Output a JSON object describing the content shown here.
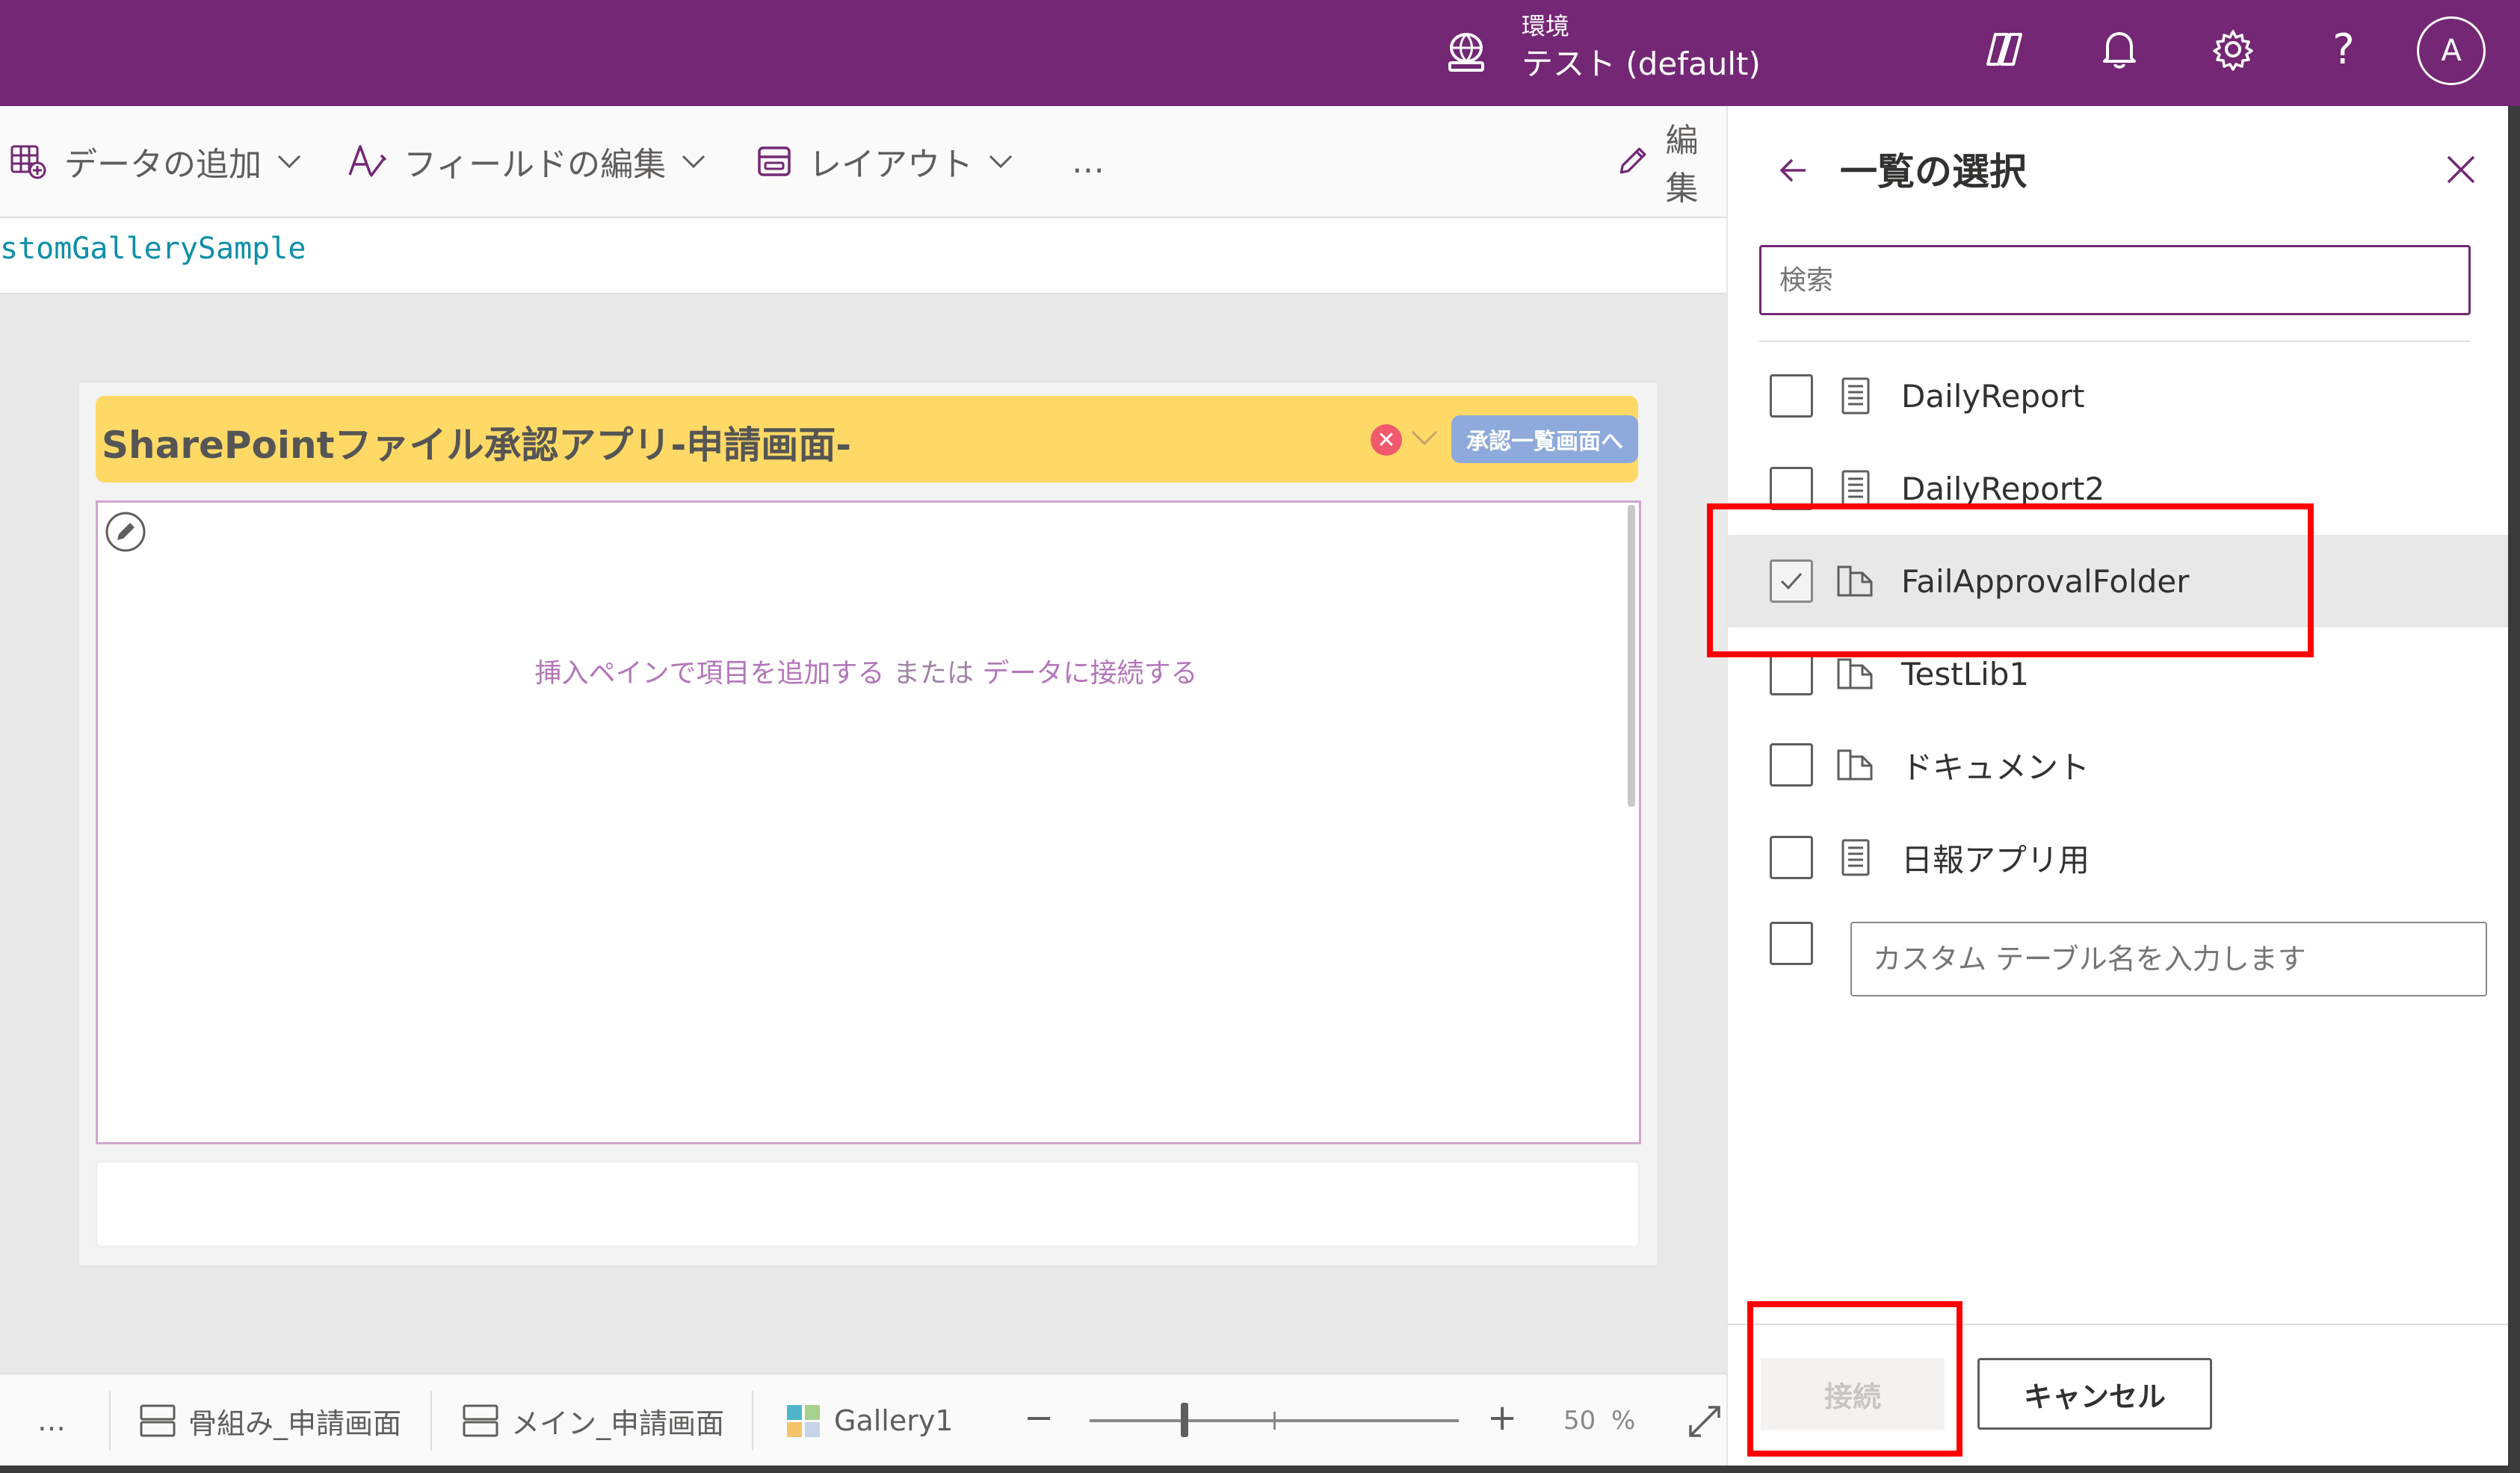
{
  "topbar": {
    "env_caption": "環境",
    "env_name": "テスト (default)",
    "avatar_initial": "A",
    "help_glyph": "?"
  },
  "toolbar": {
    "add_data": "データの追加",
    "edit_fields": "フィールドの編集",
    "layout": "レイアウト",
    "more": "…",
    "edit_partial": "編集"
  },
  "formula": {
    "text": "stomGallerySample"
  },
  "canvas": {
    "header_title": "SharePointファイル承認アプリ-申請画面-",
    "approve_button": "承認一覧画面へ",
    "close_glyph": "✕",
    "placeholder_part1": "挿入ペインで項目を追加する",
    "placeholder_part2": " または ",
    "placeholder_part3": "データに接続する"
  },
  "statusbar": {
    "more": "…",
    "crumbs": [
      {
        "label": "骨組み_申請画面",
        "icon": "screen-icon"
      },
      {
        "label": "メイン_申請画面",
        "icon": "screen-icon"
      },
      {
        "label": "Gallery1",
        "icon": "gallery-icon"
      }
    ],
    "zoom_minus": "−",
    "zoom_plus": "+",
    "zoom_value": "50",
    "zoom_unit": "%"
  },
  "panel": {
    "title": "一覧の選択",
    "search_placeholder": "検索",
    "items": [
      {
        "label": "DailyReport",
        "icon": "list-icon",
        "checked": false
      },
      {
        "label": "DailyReport2",
        "icon": "list-icon",
        "checked": false
      },
      {
        "label": "FailApprovalFolder",
        "icon": "library-icon",
        "checked": true
      },
      {
        "label": "TestLib1",
        "icon": "library-icon",
        "checked": false
      },
      {
        "label": "ドキュメント",
        "icon": "library-icon",
        "checked": false
      },
      {
        "label": "日報アプリ用",
        "icon": "list-icon",
        "checked": false
      }
    ],
    "custom_placeholder": "カスタム テーブル名を入力します",
    "connect_label": "接続",
    "cancel_label": "キャンセル"
  },
  "colors": {
    "brand": "#742774",
    "header_yellow": "#ffd966",
    "highlight": "#ff0000"
  }
}
